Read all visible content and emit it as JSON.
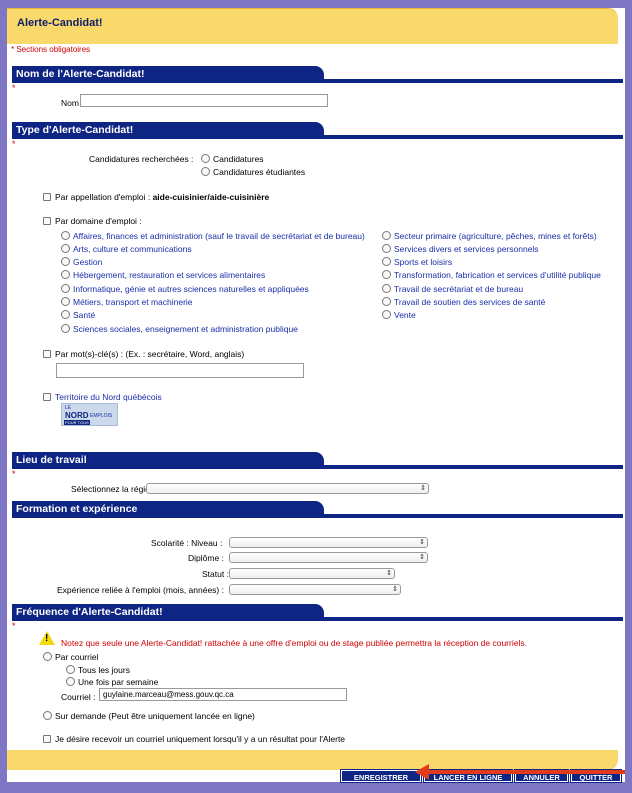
{
  "title": "Alerte-Candidat!",
  "mandatory_note": "* Sections obligatoires",
  "sections": {
    "nom": "Nom de l'Alerte-Candidat!",
    "type": "Type d'Alerte-Candidat!",
    "lieu": "Lieu de travail",
    "formation": "Formation et expérience",
    "frequence": "Fréquence d'Alerte-Candidat!"
  },
  "nom": {
    "label": "Nom :",
    "value": ""
  },
  "candidatures": {
    "label": "Candidatures recherchées :",
    "options": [
      "Candidatures",
      "Candidatures étudiantes"
    ]
  },
  "appellation": {
    "label": "Par appellation d'emploi :",
    "value": "aide-cuisinier/aide-cuisinière"
  },
  "domaine": {
    "label": "Par domaine d'emploi :",
    "left": [
      "Affaires, finances et administration (sauf le travail de secrétariat et de bureau)",
      "Arts, culture et communications",
      "Gestion",
      "Hébergement, restauration et services alimentaires",
      "Informatique, génie et autres sciences naturelles et appliquées",
      "Métiers, transport et machinerie",
      "Santé",
      "Sciences sociales, enseignement et administration publique"
    ],
    "right": [
      "Secteur primaire (agriculture, pêches, mines et forêts)",
      "Services divers et services personnels",
      "Sports et loisirs",
      "Transformation, fabrication et services d'utilité publique",
      "Travail de secrétariat et de bureau",
      "Travail de soutien des services de santé",
      "Vente"
    ]
  },
  "motcle": {
    "label": "Par mot(s)-clé(s) : (Ex. : secrétaire, Word, anglais)",
    "value": ""
  },
  "nord": {
    "label": "Territoire du Nord québécois",
    "logo_top": "LE",
    "logo_main": "NORD",
    "logo_side": "EMPLOIS",
    "logo_bottom": "POUR TOUS"
  },
  "lieu": {
    "label": "Sélectionnez la région :"
  },
  "formation": {
    "scolarite": "Scolarité : Niveau :",
    "diplome": "Diplôme :",
    "statut": "Statut :",
    "experience": "Expérience reliée à l'emploi (mois, années) :"
  },
  "frequence": {
    "warning": "Notez que seule une Alerte-Candidat! rattachée à une offre d'emploi ou de stage publiée permettra la réception de courriels.",
    "par_courriel": "Par courriel",
    "tous_jours": "Tous les jours",
    "une_fois": "Une fois par semaine",
    "courriel_label": "Courriel :",
    "courriel_value": "guylaine.marceau@mess.gouv.qc.ca",
    "sur_demande": "Sur demande (Peut être uniquement lancée en ligne)",
    "resultat": "Je désire recevoir un courriel uniquement lorsqu'il y a un résultat pour l'Alerte"
  },
  "buttons": {
    "enregistrer": "ENREGISTRER",
    "lancer": "LANCER EN LIGNE",
    "annuler": "ANNULER",
    "quitter": "QUITTER"
  },
  "colors": {
    "brand": "#0e2584",
    "accent": "#f9d96b",
    "required": "#d00000",
    "link": "#1a2fa8",
    "annotation_arrow": "#e23a1d"
  }
}
